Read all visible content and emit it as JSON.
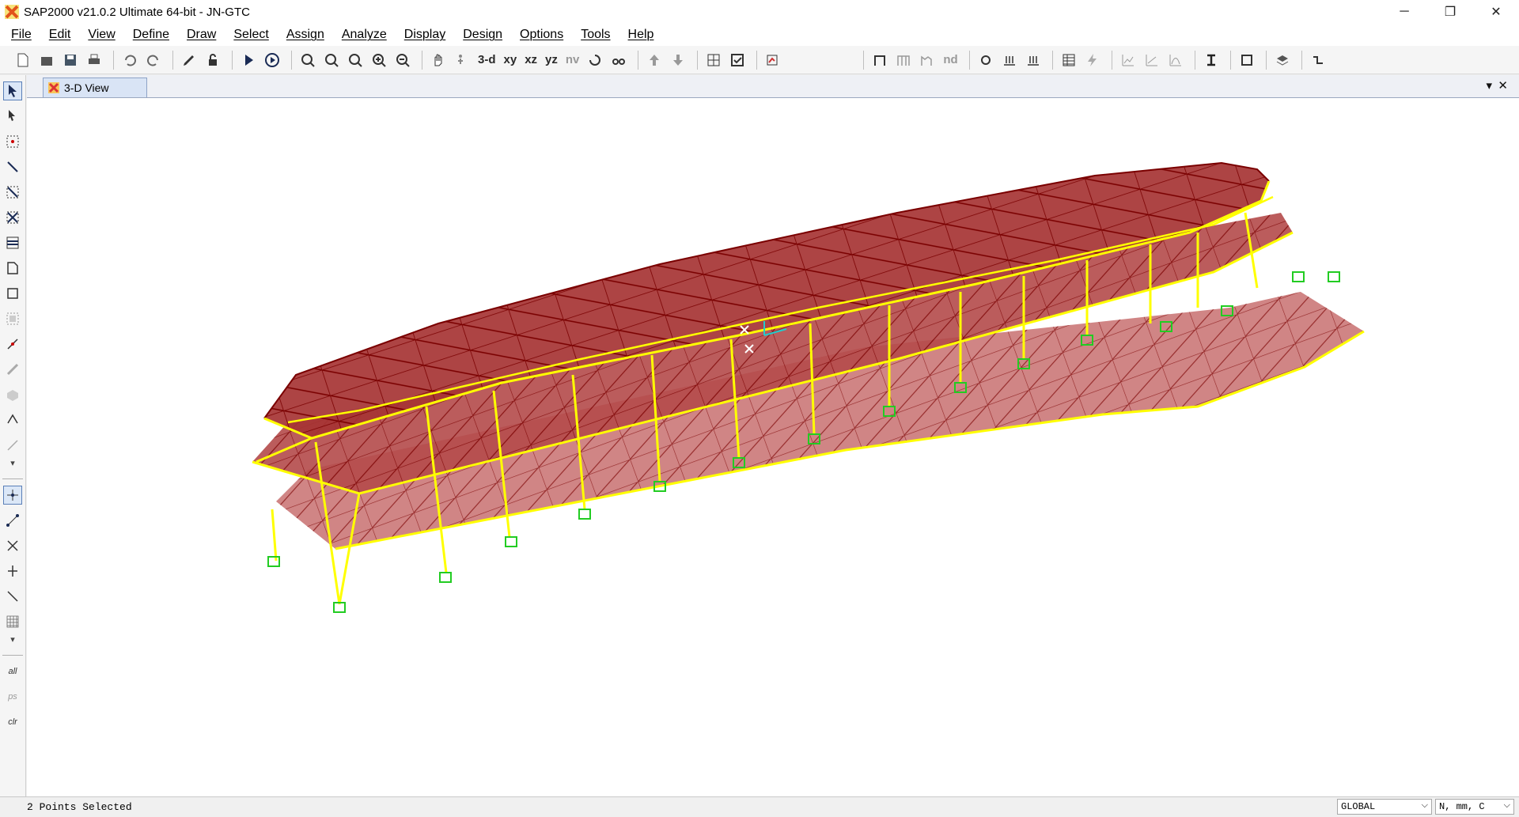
{
  "window": {
    "title": "SAP2000 v21.0.2 Ultimate 64-bit - JN-GTC",
    "minimize": "─",
    "restore": "❐",
    "close": "✕"
  },
  "menu": [
    "File",
    "Edit",
    "View",
    "Define",
    "Draw",
    "Select",
    "Assign",
    "Analyze",
    "Display",
    "Design",
    "Options",
    "Tools",
    "Help"
  ],
  "toolbar": {
    "view_3d": "3-d",
    "view_xy": "xy",
    "view_xz": "xz",
    "view_yz": "yz",
    "view_nv": "nv",
    "node_nd": "nd"
  },
  "view": {
    "tab_label": "3-D View",
    "tab_menu": "▾",
    "tab_close": "✕"
  },
  "status": {
    "message": "2 Points Selected",
    "coord_system": "GLOBAL",
    "units": "N, mm, C"
  },
  "left_toolbar_labels": {
    "all": "all",
    "ps": "ps",
    "clr": "clr"
  },
  "colors": {
    "frame": "#ffff00",
    "shell_edge": "#8b0000",
    "shell_fill": "#b22222",
    "support": "#22cc22",
    "background": "#ffffff"
  }
}
